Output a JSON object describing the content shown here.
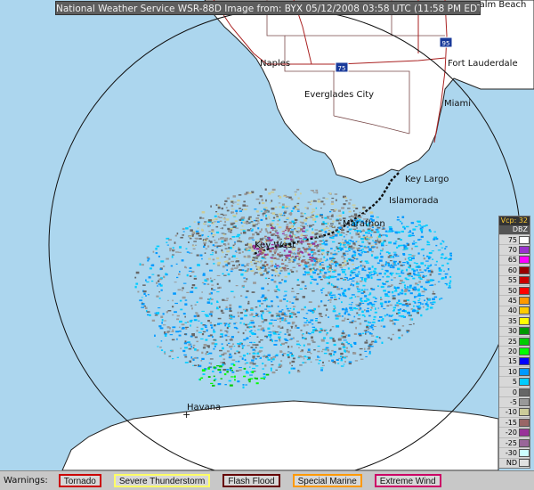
{
  "title": "National Weather Service WSR-88D Image from: BYX 05/12/2008 03:58 UTC (11:58 PM EDT)",
  "cities": [
    {
      "name": "Naples"
    },
    {
      "name": "Everglades City"
    },
    {
      "name": "Fort Lauderdale"
    },
    {
      "name": "Miami"
    },
    {
      "name": "Key Largo"
    },
    {
      "name": "Islamorada"
    },
    {
      "name": "Marathon"
    },
    {
      "name": "Key West"
    },
    {
      "name": "Havana"
    },
    {
      "name": "Palm Beach"
    }
  ],
  "highway_shields": [
    "75",
    "95"
  ],
  "legend": {
    "vcp": "Vcp: 32",
    "unit": "DBZ",
    "levels": [
      {
        "label": "75",
        "color": "#ffffff"
      },
      {
        "label": "70",
        "color": "#9933cc"
      },
      {
        "label": "65",
        "color": "#ff00ff"
      },
      {
        "label": "60",
        "color": "#990000"
      },
      {
        "label": "55",
        "color": "#cc0000"
      },
      {
        "label": "50",
        "color": "#ff0000"
      },
      {
        "label": "45",
        "color": "#ff9900"
      },
      {
        "label": "40",
        "color": "#ffcc00"
      },
      {
        "label": "35",
        "color": "#ffff00"
      },
      {
        "label": "30",
        "color": "#009900"
      },
      {
        "label": "25",
        "color": "#00cc00"
      },
      {
        "label": "20",
        "color": "#00ff00"
      },
      {
        "label": "15",
        "color": "#0000ff"
      },
      {
        "label": "10",
        "color": "#0099ff"
      },
      {
        "label": "5",
        "color": "#00ccff"
      },
      {
        "label": "0",
        "color": "#666666"
      },
      {
        "label": "-5",
        "color": "#999999"
      },
      {
        "label": "-10",
        "color": "#cccc99"
      },
      {
        "label": "-15",
        "color": "#996666"
      },
      {
        "label": "-20",
        "color": "#993399"
      },
      {
        "label": "-25",
        "color": "#996699"
      },
      {
        "label": "-30",
        "color": "#ccffff"
      },
      {
        "label": "ND",
        "color": "#e0e0e0"
      }
    ]
  },
  "warnings": {
    "label": "Warnings:",
    "items": [
      {
        "label": "Tornado",
        "color": "#cc0000"
      },
      {
        "label": "Severe Thunderstorm",
        "color": "#ffff66"
      },
      {
        "label": "Flash Flood",
        "color": "#660000"
      },
      {
        "label": "Special Marine",
        "color": "#ff9900"
      },
      {
        "label": "Extreme Wind",
        "color": "#cc0066"
      }
    ]
  }
}
